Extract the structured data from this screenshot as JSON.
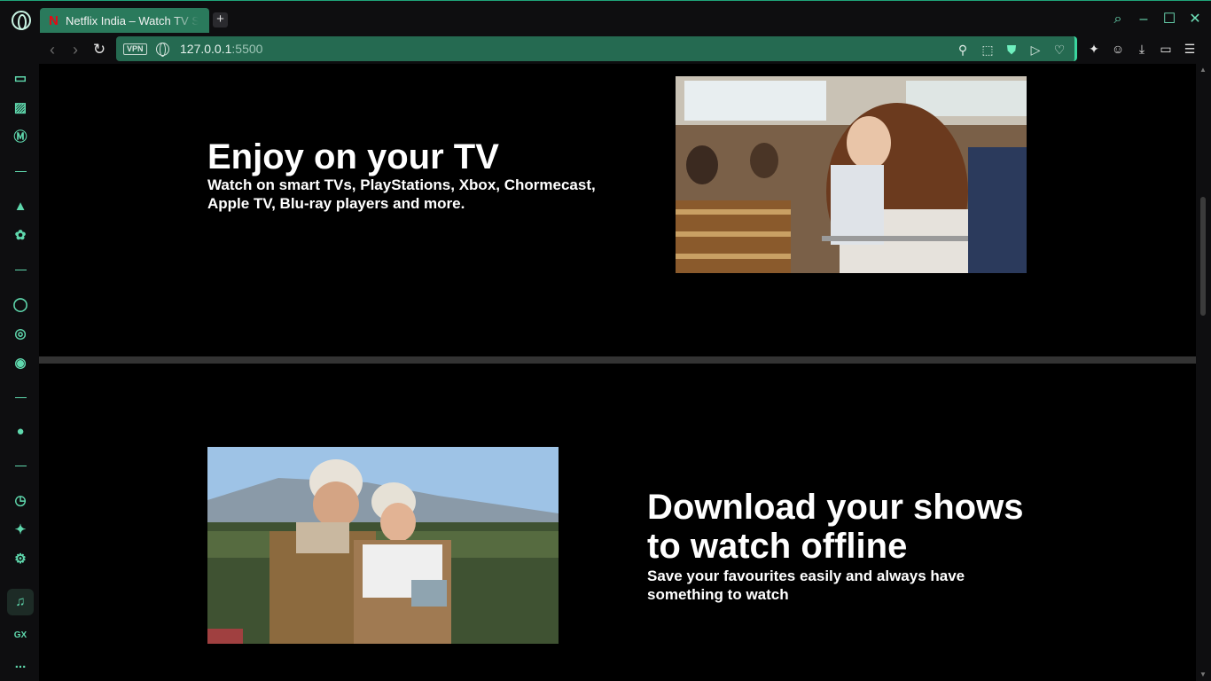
{
  "browser": {
    "tab": {
      "title": "Netflix India – Watch TV Shows Online, Watch Movies Online",
      "favicon": "netflix-icon"
    },
    "new_tab_label": "+",
    "address": {
      "vpn_label": "VPN",
      "host": "127.0.0.1",
      "port": ":5500"
    },
    "accent_color": "#3ad59e"
  },
  "sidebar": {
    "items": [
      "game-controller-icon",
      "twitch-icon",
      "messenger-icon",
      "aria-icon",
      "chatgpt-icon",
      "whatsapp-icon",
      "instagram-icon",
      "discord-icon",
      "spotify-icon",
      "history-icon",
      "extensions-icon",
      "settings-icon",
      "music-player-icon",
      "gx-icon",
      "more-icon"
    ],
    "gx_label": "GX",
    "more_label": "..."
  },
  "page": {
    "features": [
      {
        "title": "Enjoy on your TV",
        "subtitle": "Watch on smart TVs, PlayStations, Xbox, Chormecast, Apple TV, Blu-ray players and more."
      },
      {
        "title": "Download your shows to watch offline",
        "subtitle": "Save your favourites easily and always have something to watch"
      }
    ]
  }
}
